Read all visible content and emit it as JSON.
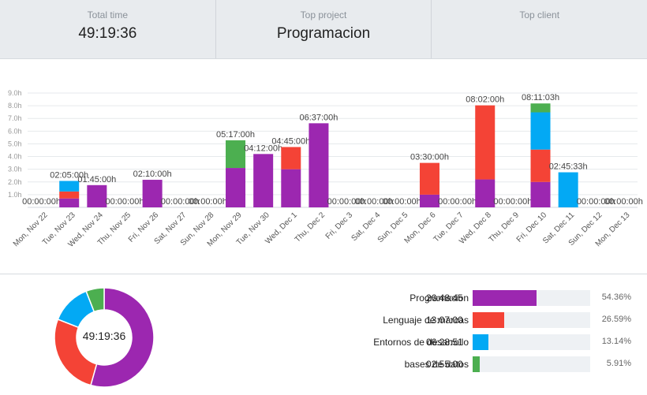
{
  "summary": {
    "total_time_label": "Total time",
    "total_time_value": "49:19:36",
    "top_project_label": "Top project",
    "top_project_value": "Programacion",
    "top_client_label": "Top client",
    "top_client_value": ""
  },
  "colors": {
    "programacion": "#9c27b0",
    "lenguaje": "#f44336",
    "entornos": "#03a9f4",
    "bases": "#4caf50"
  },
  "chart_data": [
    {
      "type": "bar",
      "stacked": true,
      "ylim": [
        0,
        9.0
      ],
      "yticks": [
        "1.0h",
        "2.0h",
        "3.0h",
        "4.0h",
        "5.0h",
        "6.0h",
        "7.0h",
        "8.0h",
        "9.0h"
      ],
      "grid": true,
      "categories": [
        "Mon, Nov 22",
        "Tue, Nov 23",
        "Wed, Nov 24",
        "Thu, Nov 25",
        "Fri, Nov 26",
        "Sat, Nov 27",
        "Sun, Nov 28",
        "Mon, Nov 29",
        "Tue, Nov 30",
        "Wed, Dec 1",
        "Thu, Dec 2",
        "Fri, Dec 3",
        "Sat, Dec 4",
        "Sun, Dec 5",
        "Mon, Dec 6",
        "Tue, Dec 7",
        "Wed, Dec 8",
        "Thu, Dec 9",
        "Fri, Dec 10",
        "Sat, Dec 11",
        "Sun, Dec 12",
        "Mon, Dec 13"
      ],
      "totals": [
        "00:00:00h",
        "02:05:00h",
        "01:45:00h",
        "00:00:00h",
        "02:10:00h",
        "00:00:00h",
        "00:00:00h",
        "05:17:00h",
        "04:12:00h",
        "04:45:00h",
        "06:37:00h",
        "00:00:00h",
        "00:00:00h",
        "00:00:00h",
        "03:30:00h",
        "00:00:00h",
        "08:02:00h",
        "00:00:00h",
        "08:11:03h",
        "02:45:33h",
        "00:00:00h",
        "00:00:00h"
      ],
      "series": [
        {
          "name": "Programacion",
          "color": "#9c27b0",
          "values": [
            0,
            0.7,
            1.75,
            0,
            2.17,
            0,
            0,
            3.1,
            4.2,
            3.0,
            6.62,
            0,
            0,
            0,
            1.0,
            0,
            2.2,
            0,
            2.0,
            0,
            0,
            0
          ]
        },
        {
          "name": "Lenguaje de marcas",
          "color": "#f44336",
          "values": [
            0,
            0.55,
            0,
            0,
            0,
            0,
            0,
            0,
            0,
            1.75,
            0,
            0,
            0,
            0,
            2.5,
            0,
            5.83,
            0,
            2.55,
            0,
            0,
            0
          ]
        },
        {
          "name": "Entornos de desarrollo",
          "color": "#03a9f4",
          "values": [
            0,
            0.83,
            0,
            0,
            0,
            0,
            0,
            0,
            0,
            0,
            0,
            0,
            0,
            0,
            0,
            0,
            0,
            0,
            2.93,
            2.76,
            0,
            0
          ]
        },
        {
          "name": "bases de datos",
          "color": "#4caf50",
          "values": [
            0,
            0,
            0,
            0,
            0,
            0,
            0,
            2.18,
            0,
            0,
            0,
            0,
            0,
            0,
            0,
            0,
            0,
            0,
            0.7,
            0,
            0,
            0
          ]
        }
      ]
    },
    {
      "type": "pie",
      "donut": true,
      "center_label": "49:19:36",
      "labels": [
        "Programacion",
        "Lenguaje de marcas",
        "Entornos de desarrollo",
        "bases de datos"
      ],
      "durations": [
        "26:48:45",
        "13:07:00",
        "06:28:51",
        "02:55:00"
      ],
      "values": [
        54.36,
        26.59,
        13.14,
        5.91
      ],
      "percent_labels": [
        "54.36%",
        "26.59%",
        "13.14%",
        "5.91%"
      ],
      "colors": [
        "#9c27b0",
        "#f44336",
        "#03a9f4",
        "#4caf50"
      ]
    }
  ]
}
